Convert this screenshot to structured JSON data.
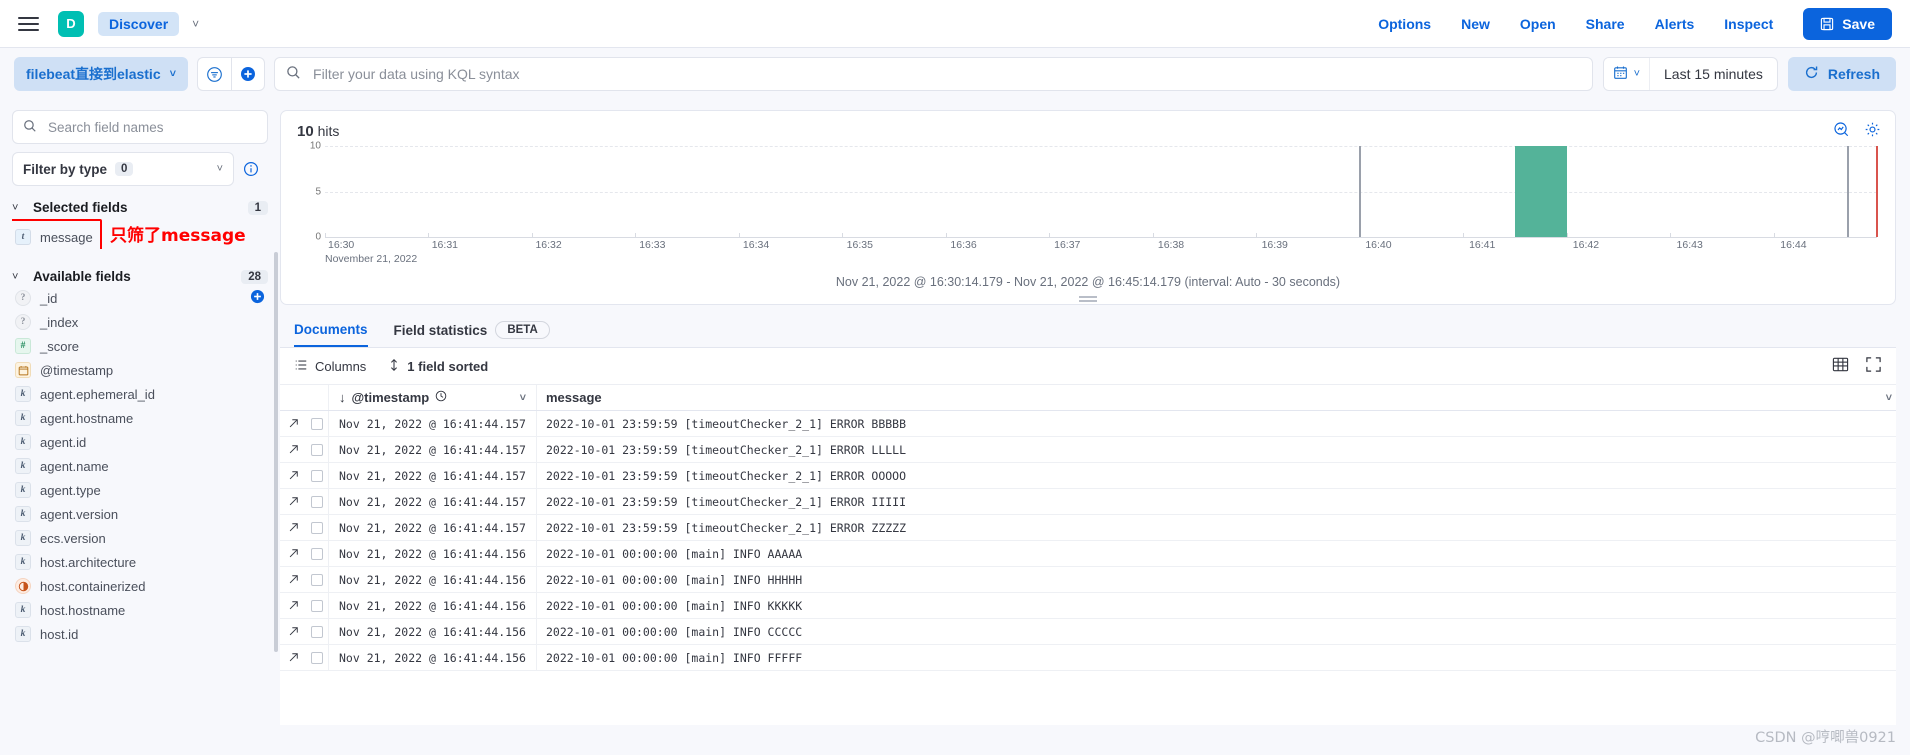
{
  "chrome": {
    "menu_icon": "hamburger-icon",
    "app_badge": "D",
    "breadcrumb": "Discover",
    "links": [
      "Options",
      "New",
      "Open",
      "Share",
      "Alerts",
      "Inspect"
    ],
    "save_label": "Save"
  },
  "query": {
    "data_view": "filebeat直接到elastic",
    "kql_placeholder": "Filter your data using KQL syntax",
    "kql_value": "",
    "date_range": "Last 15 minutes",
    "refresh_label": "Refresh"
  },
  "sidebar": {
    "search_placeholder": "Search field names",
    "search_value": "",
    "filter_by_type_label": "Filter by type",
    "filter_by_type_count": "0",
    "selected_fields_label": "Selected fields",
    "selected_fields_count": "1",
    "selected_fields": [
      {
        "name": "message",
        "type": "t"
      }
    ],
    "annotation": "只筛了message",
    "annotation_color": "#ff0000",
    "available_fields_label": "Available fields",
    "available_fields_count": "28",
    "available_fields": [
      {
        "name": "_id",
        "type": "q"
      },
      {
        "name": "_index",
        "type": "q"
      },
      {
        "name": "_score",
        "type": "num"
      },
      {
        "name": "@timestamp",
        "type": "date"
      },
      {
        "name": "agent.ephemeral_id",
        "type": "k"
      },
      {
        "name": "agent.hostname",
        "type": "k"
      },
      {
        "name": "agent.id",
        "type": "k"
      },
      {
        "name": "agent.name",
        "type": "k"
      },
      {
        "name": "agent.type",
        "type": "k"
      },
      {
        "name": "agent.version",
        "type": "k"
      },
      {
        "name": "ecs.version",
        "type": "k"
      },
      {
        "name": "host.architecture",
        "type": "k"
      },
      {
        "name": "host.containerized",
        "type": "bool"
      },
      {
        "name": "host.hostname",
        "type": "k"
      },
      {
        "name": "host.id",
        "type": "k"
      }
    ]
  },
  "main": {
    "hits_count": "10",
    "hits_label": "hits",
    "chart_range_text": "Nov 21, 2022 @ 16:30:14.179 - Nov 21, 2022 @ 16:45:14.179 (interval: Auto - 30 seconds)",
    "tabs": [
      {
        "label": "Documents",
        "active": true
      },
      {
        "label": "Field statistics",
        "active": false
      }
    ],
    "beta_label": "BETA",
    "toolbar": {
      "columns_label": "Columns",
      "sort_label": "1 field sorted"
    },
    "table": {
      "columns": [
        "@timestamp",
        "message"
      ],
      "rows": [
        {
          "timestamp": "Nov 21, 2022 @ 16:41:44.157",
          "message": "2022-10-01 23:59:59 [timeoutChecker_2_1] ERROR BBBBB"
        },
        {
          "timestamp": "Nov 21, 2022 @ 16:41:44.157",
          "message": "2022-10-01 23:59:59 [timeoutChecker_2_1] ERROR LLLLL"
        },
        {
          "timestamp": "Nov 21, 2022 @ 16:41:44.157",
          "message": "2022-10-01 23:59:59 [timeoutChecker_2_1] ERROR OOOOO"
        },
        {
          "timestamp": "Nov 21, 2022 @ 16:41:44.157",
          "message": "2022-10-01 23:59:59 [timeoutChecker_2_1] ERROR IIIII"
        },
        {
          "timestamp": "Nov 21, 2022 @ 16:41:44.157",
          "message": "2022-10-01 23:59:59 [timeoutChecker_2_1] ERROR ZZZZZ"
        },
        {
          "timestamp": "Nov 21, 2022 @ 16:41:44.156",
          "message": "2022-10-01 00:00:00 [main] INFO AAAAA"
        },
        {
          "timestamp": "Nov 21, 2022 @ 16:41:44.156",
          "message": "2022-10-01 00:00:00 [main] INFO HHHHH"
        },
        {
          "timestamp": "Nov 21, 2022 @ 16:41:44.156",
          "message": "2022-10-01 00:00:00 [main] INFO KKKKK"
        },
        {
          "timestamp": "Nov 21, 2022 @ 16:41:44.156",
          "message": "2022-10-01 00:00:00 [main] INFO CCCCC"
        },
        {
          "timestamp": "Nov 21, 2022 @ 16:41:44.156",
          "message": "2022-10-01 00:00:00 [main] INFO FFFFF"
        }
      ]
    }
  },
  "watermark": "CSDN @哼唧兽0921",
  "colors": {
    "accent": "#0b64dd",
    "bar": "#54B399",
    "brand": "#00BFB3",
    "annotation": "#ff0000"
  },
  "chart_data": {
    "type": "bar",
    "title": "10 hits",
    "xlabel": "",
    "ylabel": "",
    "ylim": [
      0,
      10
    ],
    "yticks": [
      0,
      5,
      10
    ],
    "grid": true,
    "legend": false,
    "x_date_label": "November 21, 2022",
    "tick_labels": [
      "16:30",
      "16:31",
      "16:32",
      "16:33",
      "16:34",
      "16:35",
      "16:36",
      "16:37",
      "16:38",
      "16:39",
      "16:40",
      "16:41",
      "16:42",
      "16:43",
      "16:44"
    ],
    "categories": [
      "16:41:30"
    ],
    "values": [
      10
    ],
    "subtitle": "Nov 21, 2022 @ 16:30:14.179 - Nov 21, 2022 @ 16:45:14.179 (interval: Auto - 30 seconds)",
    "annotations": [
      {
        "type": "vline",
        "x": "16:40",
        "color": "#9aa0ab"
      },
      {
        "type": "vline",
        "x": "16:44:50",
        "color": "#9aa0ab"
      },
      {
        "type": "vline",
        "x": "16:45:10",
        "color": "#d9544d"
      }
    ]
  }
}
